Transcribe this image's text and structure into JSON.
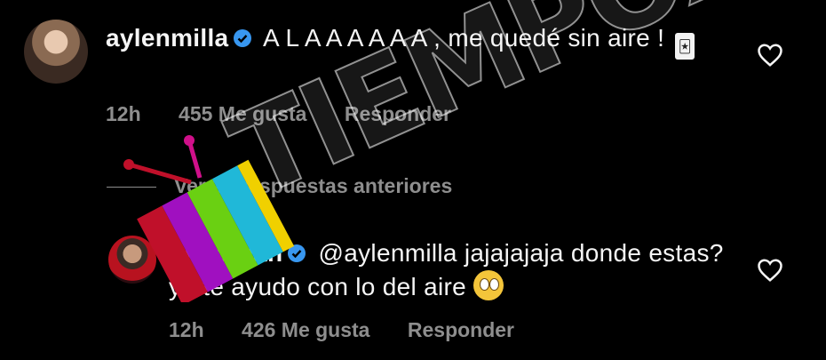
{
  "comments": [
    {
      "username": "aylenmilla",
      "text_before": "A L A A A A A A , me quedé sin aire !",
      "time": "12h",
      "likes": "455 Me gusta",
      "reply": "Responder"
    },
    {
      "username": "gmaripan",
      "text_before": "@aylenmilla jajajajaja donde estas? yo te ayudo con lo del aire",
      "time": "12h",
      "likes": "426 Me gusta",
      "reply": "Responder"
    }
  ],
  "view_more": "Ver 25 respuestas anteriores",
  "watermark": "TIEMPOX",
  "colors": {
    "background": "#000000",
    "meta": "#8e8e8e",
    "verified": "#3897f0"
  },
  "icons": [
    "verified-badge-icon",
    "heart-icon",
    "joker-card-emoji",
    "rolling-eyes-emoji"
  ]
}
